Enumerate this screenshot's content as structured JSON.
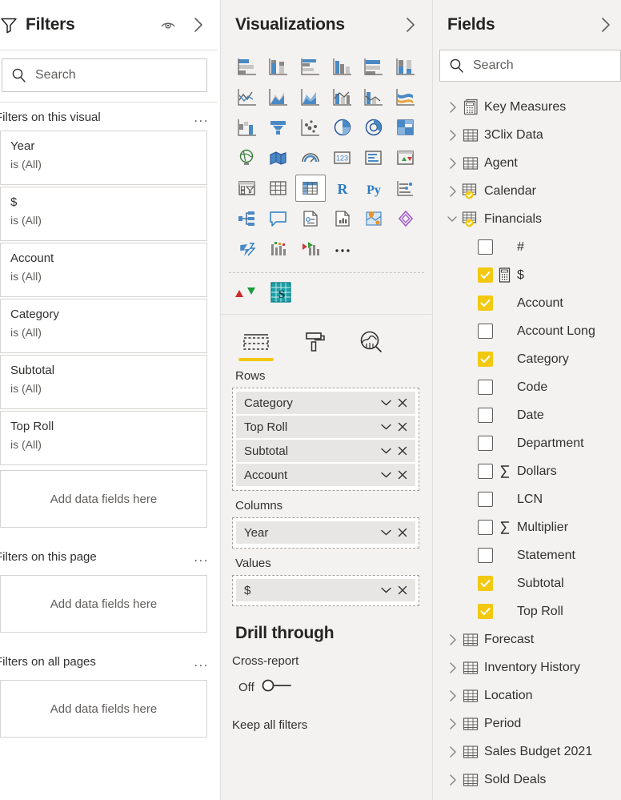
{
  "filters": {
    "title": "Filters",
    "icons": {
      "funnel": "funnel-icon",
      "eye": "eye-icon",
      "expand": "chevron-right-icon"
    },
    "search": {
      "placeholder": "Search"
    },
    "sections": [
      {
        "label": "Filters on this visual",
        "menu": "...",
        "cards": [
          {
            "name": "Year",
            "state": "is (All)"
          },
          {
            "name": "$",
            "state": "is (All)"
          },
          {
            "name": "Account",
            "state": "is (All)"
          },
          {
            "name": "Category",
            "state": "is (All)"
          },
          {
            "name": "Subtotal",
            "state": "is (All)"
          },
          {
            "name": "Top Roll",
            "state": "is (All)"
          }
        ],
        "dropzone": "Add data fields here"
      },
      {
        "label": "Filters on this page",
        "menu": "...",
        "cards": [],
        "dropzone": "Add data fields here"
      },
      {
        "label": "Filters on all pages",
        "menu": "...",
        "cards": [],
        "dropzone": "Add data fields here"
      }
    ]
  },
  "visualizations": {
    "title": "Visualizations",
    "expand_icon": "chevron-right-icon",
    "gallery": [
      {
        "name": "stacked-bar-chart-icon",
        "selected": false
      },
      {
        "name": "stacked-column-chart-icon",
        "selected": false
      },
      {
        "name": "clustered-bar-chart-icon",
        "selected": false
      },
      {
        "name": "clustered-column-chart-icon",
        "selected": false
      },
      {
        "name": "hundred-percent-stacked-bar-chart-icon",
        "selected": false
      },
      {
        "name": "hundred-percent-stacked-column-chart-icon",
        "selected": false
      },
      {
        "name": "line-chart-icon",
        "selected": false
      },
      {
        "name": "area-chart-icon",
        "selected": false
      },
      {
        "name": "stacked-area-chart-icon",
        "selected": false
      },
      {
        "name": "line-and-stacked-column-chart-icon",
        "selected": false
      },
      {
        "name": "line-and-clustered-column-chart-icon",
        "selected": false
      },
      {
        "name": "ribbon-chart-icon",
        "selected": false
      },
      {
        "name": "waterfall-chart-icon",
        "selected": false
      },
      {
        "name": "funnel-chart-icon",
        "selected": false
      },
      {
        "name": "scatter-chart-icon",
        "selected": false
      },
      {
        "name": "pie-chart-icon",
        "selected": false
      },
      {
        "name": "donut-chart-icon",
        "selected": false
      },
      {
        "name": "treemap-icon",
        "selected": false
      },
      {
        "name": "map-icon",
        "selected": false
      },
      {
        "name": "filled-map-icon",
        "selected": false
      },
      {
        "name": "gauge-icon",
        "selected": false
      },
      {
        "name": "card-icon",
        "selected": false
      },
      {
        "name": "multi-row-card-icon",
        "selected": false
      },
      {
        "name": "kpi-icon",
        "selected": false
      },
      {
        "name": "slicer-icon",
        "selected": false
      },
      {
        "name": "table-icon",
        "selected": false
      },
      {
        "name": "matrix-icon",
        "selected": true
      },
      {
        "name": "r-script-visual-icon",
        "selected": false
      },
      {
        "name": "python-visual-icon",
        "selected": false
      },
      {
        "name": "key-influencers-icon",
        "selected": false
      },
      {
        "name": "decomposition-tree-icon",
        "selected": false
      },
      {
        "name": "qna-icon",
        "selected": false
      },
      {
        "name": "smart-narrative-icon",
        "selected": false
      },
      {
        "name": "paginated-report-icon",
        "selected": false
      },
      {
        "name": "arcgis-maps-icon",
        "selected": false
      },
      {
        "name": "power-apps-icon",
        "selected": false
      },
      {
        "name": "power-automate-icon",
        "selected": false
      },
      {
        "name": "zebra-bi-tables-icon",
        "selected": false
      },
      {
        "name": "zebra-bi-charts-icon",
        "selected": false
      },
      {
        "name": "more-options-icon",
        "selected": false
      }
    ],
    "second_row": [
      {
        "name": "variance-arrows-icon"
      },
      {
        "name": "financial-matrix-icon"
      }
    ],
    "property_tabs": [
      {
        "name": "fields-tab",
        "icon": "fields-build-icon",
        "active": true
      },
      {
        "name": "format-tab",
        "icon": "paint-roller-icon",
        "active": false
      },
      {
        "name": "analytics-tab",
        "icon": "analytics-magnifier-icon",
        "active": false
      }
    ],
    "wells": [
      {
        "label": "Rows",
        "chips": [
          {
            "field": "Category"
          },
          {
            "field": "Top Roll"
          },
          {
            "field": "Subtotal"
          },
          {
            "field": "Account"
          }
        ]
      },
      {
        "label": "Columns",
        "chips": [
          {
            "field": "Year"
          }
        ]
      },
      {
        "label": "Values",
        "chips": [
          {
            "field": "$"
          }
        ]
      }
    ],
    "chip_icons": {
      "dropdown": "chevron-down-icon",
      "remove": "close-icon"
    },
    "drill": {
      "title": "Drill through",
      "cross_report_label": "Cross-report",
      "toggle_state": "Off",
      "keep_all_filters_label": "Keep all filters"
    }
  },
  "fields": {
    "title": "Fields",
    "expand_icon": "chevron-right-icon",
    "search": {
      "placeholder": "Search"
    },
    "tables": [
      {
        "label": "Key Measures",
        "icon": "measures-table-icon",
        "expanded": false,
        "checked": false
      },
      {
        "label": "3Clix Data",
        "icon": "table-icon",
        "expanded": false,
        "checked": false
      },
      {
        "label": "Agent",
        "icon": "table-icon",
        "expanded": false,
        "checked": false
      },
      {
        "label": "Calendar",
        "icon": "date-table-icon",
        "expanded": false,
        "checked": true
      },
      {
        "label": "Financials",
        "icon": "table-icon",
        "expanded": true,
        "checked": true
      }
    ],
    "financials_fields": [
      {
        "label": "#",
        "checked": false,
        "icon": null
      },
      {
        "label": "$",
        "checked": true,
        "icon": "measure-calculator-icon"
      },
      {
        "label": "Account",
        "checked": true,
        "icon": null
      },
      {
        "label": "Account Long",
        "checked": false,
        "icon": null
      },
      {
        "label": "Category",
        "checked": true,
        "icon": null
      },
      {
        "label": "Code",
        "checked": false,
        "icon": null
      },
      {
        "label": "Date",
        "checked": false,
        "icon": null
      },
      {
        "label": "Department",
        "checked": false,
        "icon": null
      },
      {
        "label": "Dollars",
        "checked": false,
        "icon": "sigma-icon"
      },
      {
        "label": "LCN",
        "checked": false,
        "icon": null
      },
      {
        "label": "Multiplier",
        "checked": false,
        "icon": "sigma-icon"
      },
      {
        "label": "Statement",
        "checked": false,
        "icon": null
      },
      {
        "label": "Subtotal",
        "checked": true,
        "icon": null
      },
      {
        "label": "Top Roll",
        "checked": true,
        "icon": null
      }
    ],
    "tables_after": [
      {
        "label": "Forecast",
        "icon": "table-icon",
        "expanded": false
      },
      {
        "label": "Inventory History",
        "icon": "table-icon",
        "expanded": false
      },
      {
        "label": "Location",
        "icon": "table-icon",
        "expanded": false
      },
      {
        "label": "Period",
        "icon": "table-icon",
        "expanded": false
      },
      {
        "label": "Sales Budget 2021",
        "icon": "table-icon",
        "expanded": false
      },
      {
        "label": "Sold Deals",
        "icon": "table-icon",
        "expanded": false
      }
    ]
  },
  "colors": {
    "accent_yellow": "#f2c811",
    "panel_bg": "#f3f2f1",
    "white": "#ffffff",
    "text": "#323130",
    "muted_text": "#605e5c",
    "border": "#c8c6c4",
    "viz_blue": "#4a89c4",
    "viz_gray": "#8a8886"
  }
}
